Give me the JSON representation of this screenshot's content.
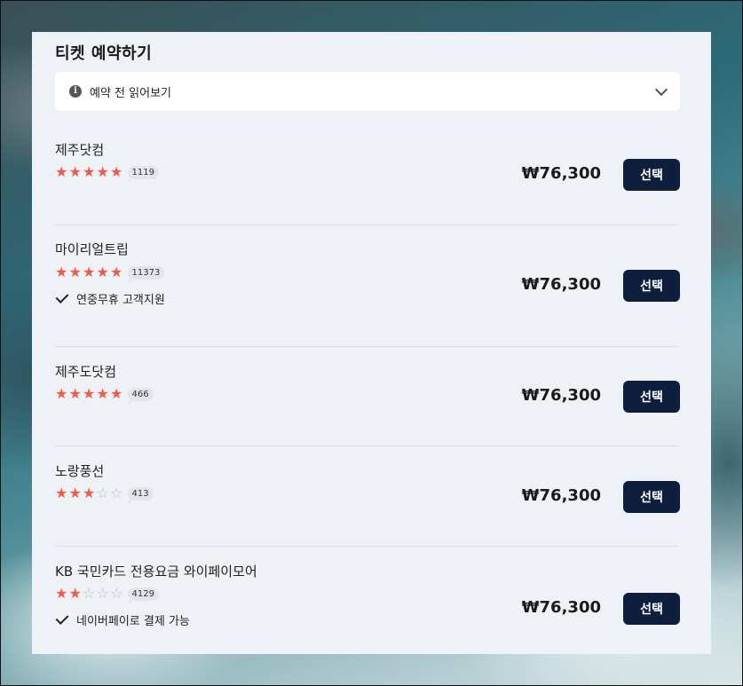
{
  "panel": {
    "title": "티켓 예약하기",
    "notice": {
      "label": "예약 전 읽어보기",
      "icon": "info-icon",
      "toggle_icon": "chevron-down-icon"
    }
  },
  "colors": {
    "star_on": "#f05a47",
    "star_off": "#b8bcc2",
    "button_bg": "#0d1f3c",
    "panel_bg": "#eef1f5"
  },
  "offers": [
    {
      "vendor": "제주닷컴",
      "rating": 5,
      "review_count": "1119",
      "feature": "",
      "price": "₩76,300",
      "button": "선택"
    },
    {
      "vendor": "마이리얼트립",
      "rating": 5,
      "review_count": "11373",
      "feature": "연중무휴 고객지원",
      "price": "₩76,300",
      "button": "선택"
    },
    {
      "vendor": "제주도닷컴",
      "rating": 5,
      "review_count": "466",
      "feature": "",
      "price": "₩76,300",
      "button": "선택"
    },
    {
      "vendor": "노랑풍선",
      "rating": 3,
      "review_count": "413",
      "feature": "",
      "price": "₩76,300",
      "button": "선택"
    },
    {
      "vendor": "KB 국민카드 전용요금 와이페이모어",
      "rating": 2,
      "review_count": "4129",
      "feature": "네이버페이로 결제 가능",
      "price": "₩76,300",
      "button": "선택"
    }
  ]
}
